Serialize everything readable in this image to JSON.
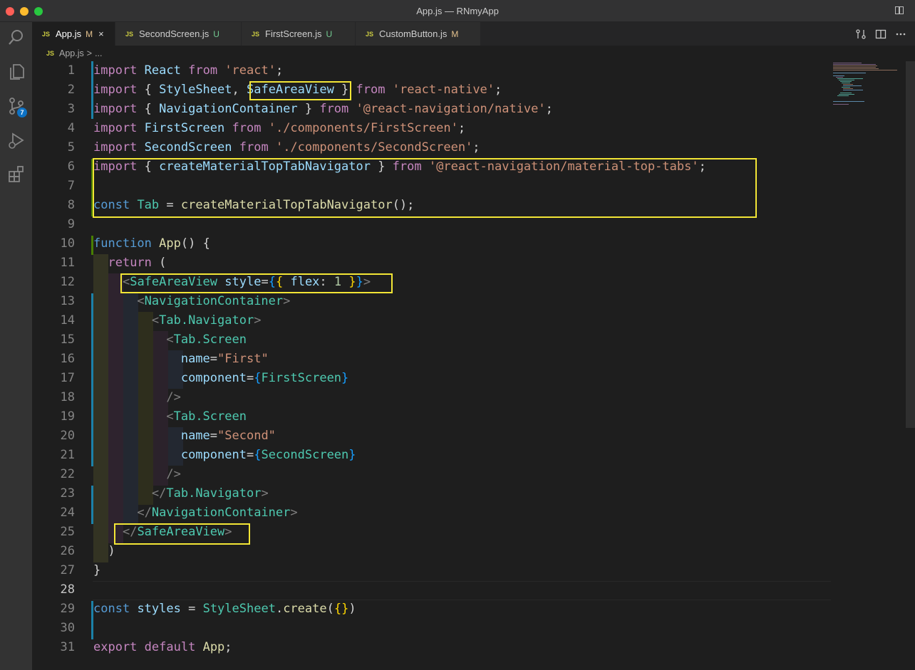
{
  "window": {
    "title": "App.js — RNmyApp"
  },
  "activity_bar": {
    "items": [
      {
        "name": "explorer"
      },
      {
        "name": "search"
      },
      {
        "name": "source-control",
        "badge": "7"
      },
      {
        "name": "run-debug"
      },
      {
        "name": "extensions"
      }
    ]
  },
  "tabs": [
    {
      "label": "App.js",
      "status": "M",
      "active": true
    },
    {
      "label": "SecondScreen.js",
      "status": "U",
      "active": false
    },
    {
      "label": "FirstScreen.js",
      "status": "U",
      "active": false
    },
    {
      "label": "CustomButton.js",
      "status": "M",
      "active": false
    }
  ],
  "tab_file_icon": "JS",
  "close_glyph": "×",
  "breadcrumb": {
    "file": "App.js",
    "separator": ">",
    "rest": "..."
  },
  "editor": {
    "current_line": 28,
    "line_numbers": [
      "1",
      "2",
      "3",
      "4",
      "5",
      "6",
      "7",
      "8",
      "9",
      "10",
      "11",
      "12",
      "13",
      "14",
      "15",
      "16",
      "17",
      "18",
      "19",
      "20",
      "21",
      "22",
      "23",
      "24",
      "25",
      "26",
      "27",
      "28",
      "29",
      "30",
      "31"
    ],
    "colors": {
      "keyword": "#c586c0",
      "storage": "#569cd6",
      "variable": "#9cdcfe",
      "string": "#ce9178",
      "function": "#dcdcaa",
      "component": "#4ec9b0",
      "tag_punct": "#808080",
      "brace": "#ffd700",
      "brace2": "#da70d6",
      "brace3": "#179fff",
      "plain": "#d4d4d4",
      "number": "#b5cea8",
      "highlight": "#f3e636"
    },
    "lines": [
      [
        [
          "keyword",
          "import"
        ],
        [
          "plain",
          " "
        ],
        [
          "variable",
          "React"
        ],
        [
          "plain",
          " "
        ],
        [
          "keyword",
          "from"
        ],
        [
          "plain",
          " "
        ],
        [
          "string",
          "'react'"
        ],
        [
          "plain",
          ";"
        ]
      ],
      [
        [
          "keyword",
          "import"
        ],
        [
          "plain",
          " { "
        ],
        [
          "variable",
          "StyleSheet"
        ],
        [
          "plain",
          ", "
        ],
        [
          "variable",
          "SafeAreaView"
        ],
        [
          "plain",
          " } "
        ],
        [
          "keyword",
          "from"
        ],
        [
          "plain",
          " "
        ],
        [
          "string",
          "'react-native'"
        ],
        [
          "plain",
          ";"
        ]
      ],
      [
        [
          "keyword",
          "import"
        ],
        [
          "plain",
          " { "
        ],
        [
          "variable",
          "NavigationContainer"
        ],
        [
          "plain",
          " } "
        ],
        [
          "keyword",
          "from"
        ],
        [
          "plain",
          " "
        ],
        [
          "string",
          "'@react-navigation/native'"
        ],
        [
          "plain",
          ";"
        ]
      ],
      [
        [
          "keyword",
          "import"
        ],
        [
          "plain",
          " "
        ],
        [
          "variable",
          "FirstScreen"
        ],
        [
          "plain",
          " "
        ],
        [
          "keyword",
          "from"
        ],
        [
          "plain",
          " "
        ],
        [
          "string",
          "'./components/FirstScreen'"
        ],
        [
          "plain",
          ";"
        ]
      ],
      [
        [
          "keyword",
          "import"
        ],
        [
          "plain",
          " "
        ],
        [
          "variable",
          "SecondScreen"
        ],
        [
          "plain",
          " "
        ],
        [
          "keyword",
          "from"
        ],
        [
          "plain",
          " "
        ],
        [
          "string",
          "'./components/SecondScreen'"
        ],
        [
          "plain",
          ";"
        ]
      ],
      [
        [
          "keyword",
          "import"
        ],
        [
          "plain",
          " { "
        ],
        [
          "variable",
          "createMaterialTopTabNavigator"
        ],
        [
          "plain",
          " } "
        ],
        [
          "keyword",
          "from"
        ],
        [
          "plain",
          " "
        ],
        [
          "string",
          "'@react-navigation/material-top-tabs'"
        ],
        [
          "plain",
          ";"
        ]
      ],
      [],
      [
        [
          "storage",
          "const"
        ],
        [
          "plain",
          " "
        ],
        [
          "component",
          "Tab"
        ],
        [
          "plain",
          " = "
        ],
        [
          "function",
          "createMaterialTopTabNavigator"
        ],
        [
          "plain",
          "();"
        ]
      ],
      [],
      [
        [
          "storage",
          "function"
        ],
        [
          "plain",
          " "
        ],
        [
          "function",
          "App"
        ],
        [
          "plain",
          "() {"
        ]
      ],
      [
        [
          "plain",
          "  "
        ],
        [
          "keyword",
          "return"
        ],
        [
          "plain",
          " ("
        ]
      ],
      [
        [
          "plain",
          "    "
        ],
        [
          "tag_punct",
          "<"
        ],
        [
          "component",
          "SafeAreaView"
        ],
        [
          "plain",
          " "
        ],
        [
          "variable",
          "style"
        ],
        [
          "plain",
          "="
        ],
        [
          "brace3",
          "{"
        ],
        [
          "brace",
          "{"
        ],
        [
          "plain",
          " "
        ],
        [
          "variable",
          "flex"
        ],
        [
          "plain",
          ": "
        ],
        [
          "number",
          "1"
        ],
        [
          "plain",
          " "
        ],
        [
          "brace",
          "}"
        ],
        [
          "brace3",
          "}"
        ],
        [
          "tag_punct",
          ">"
        ]
      ],
      [
        [
          "plain",
          "      "
        ],
        [
          "tag_punct",
          "<"
        ],
        [
          "component",
          "NavigationContainer"
        ],
        [
          "tag_punct",
          ">"
        ]
      ],
      [
        [
          "plain",
          "        "
        ],
        [
          "tag_punct",
          "<"
        ],
        [
          "component",
          "Tab.Navigator"
        ],
        [
          "tag_punct",
          ">"
        ]
      ],
      [
        [
          "plain",
          "          "
        ],
        [
          "tag_punct",
          "<"
        ],
        [
          "component",
          "Tab.Screen"
        ]
      ],
      [
        [
          "plain",
          "            "
        ],
        [
          "variable",
          "name"
        ],
        [
          "plain",
          "="
        ],
        [
          "string",
          "\"First\""
        ]
      ],
      [
        [
          "plain",
          "            "
        ],
        [
          "variable",
          "component"
        ],
        [
          "plain",
          "="
        ],
        [
          "brace3",
          "{"
        ],
        [
          "component",
          "FirstScreen"
        ],
        [
          "brace3",
          "}"
        ]
      ],
      [
        [
          "plain",
          "          "
        ],
        [
          "tag_punct",
          "/>"
        ]
      ],
      [
        [
          "plain",
          "          "
        ],
        [
          "tag_punct",
          "<"
        ],
        [
          "component",
          "Tab.Screen"
        ]
      ],
      [
        [
          "plain",
          "            "
        ],
        [
          "variable",
          "name"
        ],
        [
          "plain",
          "="
        ],
        [
          "string",
          "\"Second\""
        ]
      ],
      [
        [
          "plain",
          "            "
        ],
        [
          "variable",
          "component"
        ],
        [
          "plain",
          "="
        ],
        [
          "brace3",
          "{"
        ],
        [
          "component",
          "SecondScreen"
        ],
        [
          "brace3",
          "}"
        ]
      ],
      [
        [
          "plain",
          "          "
        ],
        [
          "tag_punct",
          "/>"
        ]
      ],
      [
        [
          "plain",
          "        "
        ],
        [
          "tag_punct",
          "</"
        ],
        [
          "component",
          "Tab.Navigator"
        ],
        [
          "tag_punct",
          ">"
        ]
      ],
      [
        [
          "plain",
          "      "
        ],
        [
          "tag_punct",
          "</"
        ],
        [
          "component",
          "NavigationContainer"
        ],
        [
          "tag_punct",
          ">"
        ]
      ],
      [
        [
          "plain",
          "    "
        ],
        [
          "tag_punct",
          "</"
        ],
        [
          "component",
          "SafeAreaView"
        ],
        [
          "tag_punct",
          ">"
        ]
      ],
      [
        [
          "plain",
          "  )"
        ]
      ],
      [
        [
          "plain",
          "}"
        ]
      ],
      [],
      [
        [
          "storage",
          "const"
        ],
        [
          "plain",
          " "
        ],
        [
          "variable",
          "styles"
        ],
        [
          "plain",
          " = "
        ],
        [
          "component",
          "StyleSheet"
        ],
        [
          "plain",
          "."
        ],
        [
          "function",
          "create"
        ],
        [
          "plain",
          "("
        ],
        [
          "brace",
          "{"
        ],
        [
          "brace",
          "}"
        ],
        [
          "plain",
          ")"
        ]
      ],
      [],
      [
        [
          "keyword",
          "export"
        ],
        [
          "plain",
          " "
        ],
        [
          "keyword",
          "default"
        ],
        [
          "plain",
          " "
        ],
        [
          "function",
          "App"
        ],
        [
          "plain",
          ";"
        ]
      ]
    ]
  }
}
